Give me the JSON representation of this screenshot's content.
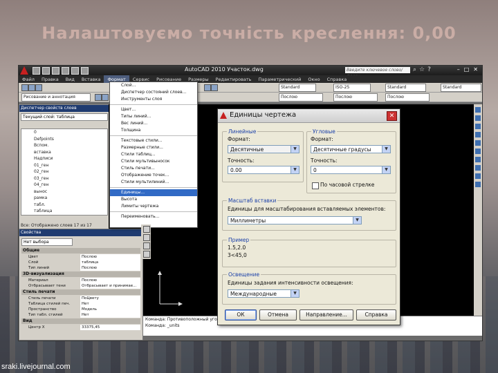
{
  "slide": {
    "title": "Налаштовуємо точність креслення: 0,00",
    "watermark": "sraki.livejournal.com"
  },
  "app": {
    "title": "AutoCAD 2010   Участок.dwg",
    "search_placeholder": "Введите ключевое слово/фразу",
    "menu": [
      "Файл",
      "Правка",
      "Вид",
      "Вставка",
      "Формат",
      "Сервис",
      "Рисование",
      "Размеры",
      "Редактировать",
      "Параметрический",
      "Окно",
      "Справка"
    ],
    "active_menu_index": 4,
    "toolbar1": {
      "textstyle": "Standard",
      "dimstyle": "ISO-25",
      "tablestyle": "Standard",
      "mlstyle": "Standard"
    },
    "toolbar2": {
      "workspace": "Рисование и аннотация",
      "color": "Послою",
      "linetype": "Послою",
      "lineweight": "Послою"
    }
  },
  "palette": {
    "title": "Диспетчер свойств слоев",
    "current": "Текущий слой: таблица",
    "layers": [
      "0",
      "Defpoints",
      "Вспом.",
      "вставка",
      "Надписи",
      "01_ген",
      "02_ген",
      "03_ген",
      "04_ген",
      "вынос",
      "рамка",
      "табл.",
      "таблица"
    ],
    "status": "Все: Отображено слоев 17 из 17"
  },
  "properties": {
    "title": "Свойства",
    "selection": "Нет выбора",
    "sections": [
      {
        "title": "Общие",
        "rows": [
          [
            "Цвет",
            "Послою"
          ],
          [
            "Слой",
            "таблица"
          ],
          [
            "Тип линий",
            "Послою"
          ]
        ]
      },
      {
        "title": "3D-визуализация",
        "rows": [
          [
            "Материал",
            "Послою"
          ],
          [
            "Отбрасывает тени",
            "Отбрасывает и принимае..."
          ]
        ]
      },
      {
        "title": "Стиль печати",
        "rows": [
          [
            "Стиль печати",
            "ПоЦвету"
          ],
          [
            "Таблица стилей печ.",
            "Нет"
          ],
          [
            "Пространство",
            "Модель"
          ],
          [
            "Тип табл. стилей",
            "Нет"
          ]
        ]
      },
      {
        "title": "Вид",
        "rows": [
          [
            "Центр X",
            "33375,45"
          ]
        ]
      }
    ]
  },
  "format_menu": {
    "items": [
      "Слой...",
      "Диспетчер состояний слоев...",
      "Инструменты слоя",
      "Цвет...",
      "Типы линий...",
      "Вес линий...",
      "Толщина",
      "Текстовые стили...",
      "Размерные стили...",
      "Стили таблиц...",
      "Стили мультивыносок",
      "Стиль печати...",
      "Отображение точек...",
      "Стили мультилиний...",
      "Единицы...",
      "Высота",
      "Лимиты чертежа",
      "Переименовать..."
    ],
    "highlighted_index": 14
  },
  "command": {
    "line1": "Команда: Противоположный угол:",
    "line2": "Команда: _units"
  },
  "dialog": {
    "title": "Единицы чертежа",
    "close_symbol": "✕",
    "linear": {
      "group": "Линейные",
      "format_label": "Формат:",
      "format_value": "Десятичные",
      "precision_label": "Точность:",
      "precision_value": "0.00"
    },
    "angular": {
      "group": "Угловые",
      "format_label": "Формат:",
      "format_value": "Десятичные градусы",
      "precision_label": "Точность:",
      "precision_value": "0",
      "clockwise_label": "По часовой стрелке",
      "clockwise_checked": false
    },
    "insert": {
      "group": "Масштаб вставки",
      "caption": "Единицы для масштабирования вставляемых элементов:",
      "value": "Миллиметры"
    },
    "sample": {
      "group": "Пример",
      "line1": "1.5,2.0",
      "line2": "3<45,0"
    },
    "lighting": {
      "group": "Освещение",
      "caption": "Единицы задания интенсивности освещения:",
      "value": "Международные"
    },
    "buttons": {
      "ok": "ОК",
      "cancel": "Отмена",
      "direction": "Направление...",
      "help": "Справка"
    }
  },
  "colors": {
    "accent": "#316ac5",
    "title_bg": "#1f3b70",
    "dialog_bg": "#ece9d8",
    "group_label": "#1a3fa8"
  }
}
